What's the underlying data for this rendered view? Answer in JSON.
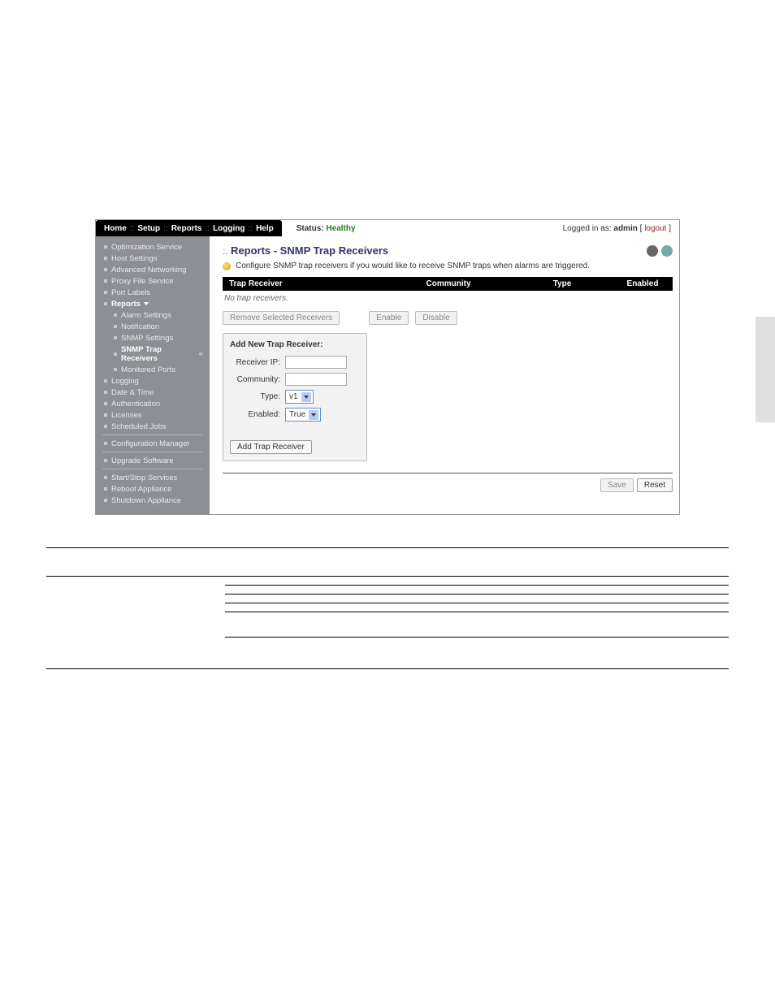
{
  "nav": {
    "home": "Home",
    "setup": "Setup",
    "reports": "Reports",
    "logging": "Logging",
    "help": "Help",
    "sep": "::"
  },
  "status": {
    "label": "Status:",
    "value": "Healthy"
  },
  "login": {
    "prefix": "Logged in as: ",
    "user": "admin",
    "bracket_open": " [ ",
    "logout": "logout",
    "bracket_close": " ]"
  },
  "sidebar": {
    "optimization": "Optimization Service",
    "host": "Host Settings",
    "advnet": "Advanced Networking",
    "proxy": "Proxy File Service",
    "portlabels": "Port Labels",
    "reports": "Reports",
    "alarm": "Alarm Settings",
    "notification": "Notification",
    "snmp_settings": "SNMP Settings",
    "snmp_trap": "SNMP Trap Receivers",
    "monitored": "Monitored Ports",
    "logging": "Logging",
    "datetime": "Date & Time",
    "auth": "Authentication",
    "licenses": "Licenses",
    "sched": "Scheduled Jobs",
    "config": "Configuration Manager",
    "upgrade": "Upgrade Software",
    "startstop": "Start/Stop Services",
    "reboot": "Reboot Appliance",
    "shutdown": "Shutdown Appliance"
  },
  "content": {
    "title_pre": ":. ",
    "title": "Reports - SNMP Trap Receivers",
    "hint": "Configure SNMP trap receivers if you would like to receive SNMP traps when alarms are triggered.",
    "cols": {
      "c1": "Trap Receiver",
      "c2": "Community",
      "c3": "Type",
      "c4": "Enabled"
    },
    "empty": "No trap receivers.",
    "buttons": {
      "remove": "Remove Selected Receivers",
      "enable": "Enable",
      "disable": "Disable",
      "save": "Save",
      "reset": "Reset"
    },
    "form": {
      "title": "Add New Trap Receiver:",
      "receiver_ip": "Receiver IP:",
      "community": "Community:",
      "type": "Type:",
      "type_value": "v1",
      "enabled": "Enabled:",
      "enabled_value": "True",
      "add": "Add Trap Receiver"
    }
  }
}
